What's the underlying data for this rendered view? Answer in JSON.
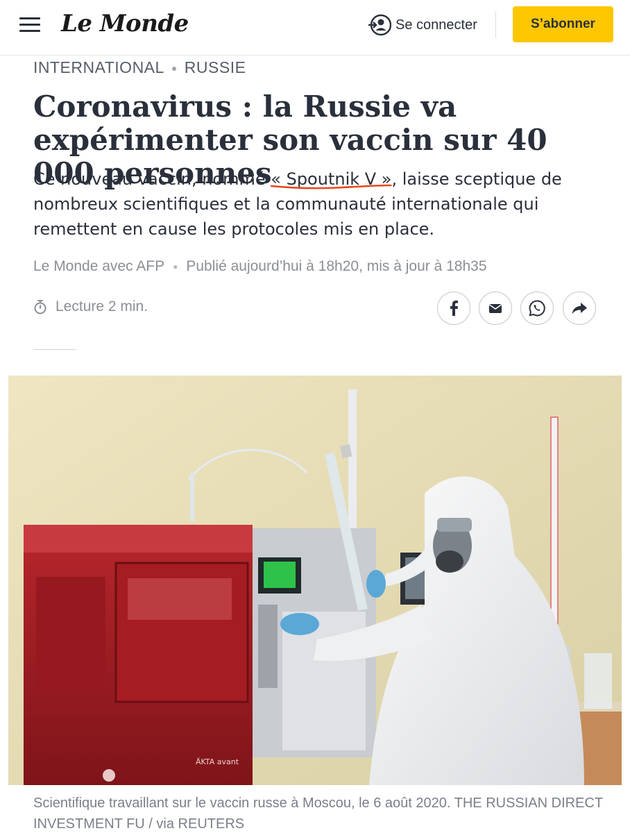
{
  "header": {
    "logo": "Le Monde",
    "login_label": "Se connecter",
    "subscribe_label": "S’abonner",
    "accent": "#ffc700"
  },
  "breadcrumb": {
    "section": "INTERNATIONAL",
    "subsection": "RUSSIE"
  },
  "article": {
    "title": "Coronavirus : la Russie va expérimenter son vaccin sur 40 000 personnes",
    "lead_before": "Ce nouveau vaccin, nommé ",
    "lead_highlight": "« Spoutnik V »",
    "lead_after": ", laisse sceptique de nombreux scientifiques et la communauté internationale qui remettent en cause les protocoles mis en place.",
    "author": "Le Monde avec AFP",
    "published": "Publié aujourd’hui à 18h20, mis à jour à 18h35",
    "reading_time": "Lecture 2 min.",
    "annotation_color": "#e8451a"
  },
  "share": {
    "icons": [
      "facebook-icon",
      "mail-icon",
      "whatsapp-icon",
      "share-icon"
    ]
  },
  "photo": {
    "caption": "Scientifique travaillant sur le vaccin russe à Moscou, le 6 août 2020. THE RUSSIAN DIRECT INVESTMENT FU / via REUTERS",
    "machine_label": "ÄKTA avant"
  }
}
